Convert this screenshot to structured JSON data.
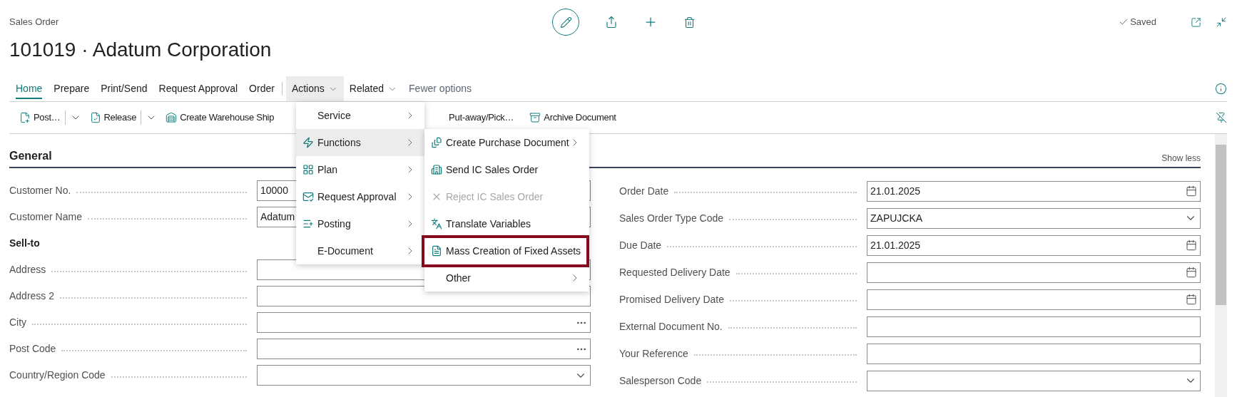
{
  "header": {
    "caption": "Sales Order",
    "title": "101019 · Adatum Corporation",
    "status": "Saved"
  },
  "nav_tabs": [
    {
      "label": "Home",
      "selected": true
    },
    {
      "label": "Prepare",
      "selected": false
    },
    {
      "label": "Print/Send",
      "selected": false
    },
    {
      "label": "Request Approval",
      "selected": false
    },
    {
      "label": "Order",
      "selected": false
    }
  ],
  "nav_menus": [
    {
      "label": "Actions",
      "expanded": true
    },
    {
      "label": "Related",
      "expanded": false
    }
  ],
  "nav_link": "Fewer options",
  "toolbar": [
    {
      "label": "Post…",
      "split": true
    },
    {
      "label": "Release",
      "split": true
    },
    {
      "label": "Create Warehouse Ship",
      "split": false
    },
    {
      "label": "Put-away/Pick…",
      "split": false
    },
    {
      "label": "Archive Document",
      "split": false
    }
  ],
  "section": {
    "title": "General",
    "toggle": "Show less"
  },
  "left_fields": [
    {
      "label": "Customer No.",
      "kind": "text",
      "value": "10000"
    },
    {
      "label": "Customer Name",
      "kind": "text",
      "value": "Adatum"
    },
    {
      "label": "Sell-to",
      "kind": "heading"
    },
    {
      "label": "Address",
      "kind": "text"
    },
    {
      "label": "Address 2",
      "kind": "text"
    },
    {
      "label": "City",
      "kind": "lookup"
    },
    {
      "label": "Post Code",
      "kind": "lookup"
    },
    {
      "label": "Country/Region Code",
      "kind": "dropdown"
    }
  ],
  "right_fields": [
    {
      "label": "Order Date",
      "kind": "date",
      "value": "21.01.2025"
    },
    {
      "label": "Sales Order Type Code",
      "kind": "dropdown",
      "value": "ZAPUJCKA"
    },
    {
      "label": "Due Date",
      "kind": "date",
      "value": "21.01.2025"
    },
    {
      "label": "Requested Delivery Date",
      "kind": "date"
    },
    {
      "label": "Promised Delivery Date",
      "kind": "date"
    },
    {
      "label": "External Document No.",
      "kind": "text"
    },
    {
      "label": "Your Reference",
      "kind": "text"
    },
    {
      "label": "Salesperson Code",
      "kind": "dropdown"
    }
  ],
  "actions_menu": [
    {
      "label": "Service",
      "selected": false
    },
    {
      "label": "Functions",
      "selected": true
    },
    {
      "label": "Plan",
      "selected": false
    },
    {
      "label": "Request Approval",
      "selected": false
    },
    {
      "label": "Posting",
      "selected": false
    },
    {
      "label": "E-Document",
      "selected": false
    }
  ],
  "functions_submenu": [
    {
      "label": "Create Purchase Document",
      "submenu": true,
      "disabled": false,
      "highlighted": false
    },
    {
      "label": "Send IC Sales Order",
      "submenu": false,
      "disabled": false,
      "highlighted": false
    },
    {
      "label": "Reject IC Sales Order",
      "submenu": false,
      "disabled": true,
      "highlighted": false
    },
    {
      "label": "Translate Variables",
      "submenu": false,
      "disabled": false,
      "highlighted": false
    },
    {
      "label": "Mass Creation of Fixed Assets",
      "submenu": false,
      "disabled": false,
      "highlighted": true
    },
    {
      "label": "Other",
      "submenu": true,
      "disabled": false,
      "highlighted": false
    }
  ]
}
